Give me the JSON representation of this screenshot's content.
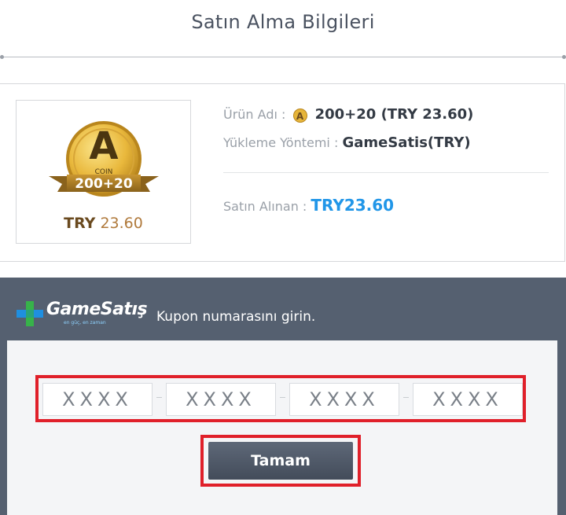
{
  "header": {
    "title": "Satın Alma Bilgileri"
  },
  "product": {
    "image": {
      "coin_letter": "A",
      "coin_word": "COIN",
      "ribbon_amount": "200+20",
      "price_currency": "TRY",
      "price_value": "23.60"
    },
    "name_label": "Ürün Adı :",
    "name_icon": "coin-icon",
    "name_icon_letter": "A",
    "name_value": "200+20 (TRY 23.60)",
    "method_label": "Yükleme Yöntemi :",
    "method_value": "GameSatis(TRY)",
    "purchased_label": "Satın Alınan :",
    "purchased_value": "TRY23.60"
  },
  "coupon": {
    "logo_text": "GameSatış",
    "logo_sub": "en güç, en zaman",
    "prompt": "Kupon numarasını girin.",
    "inputs": [
      {
        "placeholder": "XXXX"
      },
      {
        "placeholder": "XXXX"
      },
      {
        "placeholder": "XXXX"
      },
      {
        "placeholder": "XXXX"
      }
    ],
    "submit_label": "Tamam"
  },
  "colors": {
    "panel": "#556070",
    "highlight": "#e0202a",
    "price_blue": "#2196e8",
    "coin_gold": "#e6b53a",
    "logo_green": "#37b34a",
    "logo_blue": "#1f8fe0"
  }
}
